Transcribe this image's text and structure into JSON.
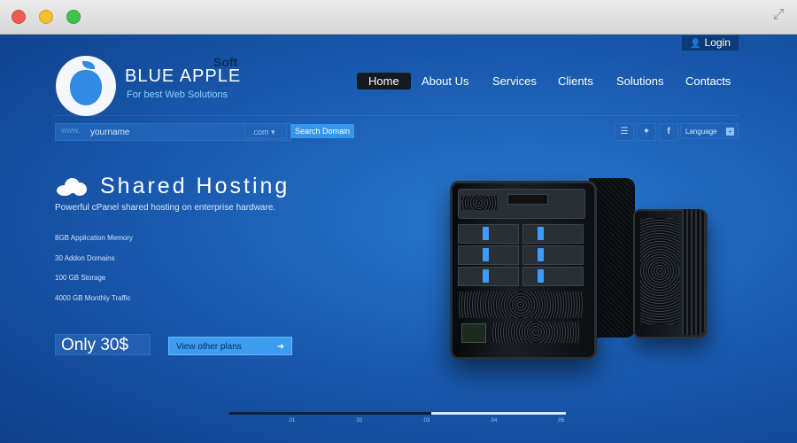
{
  "browser": {
    "expand_icon": "expand-arrows-icon"
  },
  "header": {
    "login_label": "Login",
    "logo": {
      "soft": "Soft",
      "name": "BLUE APPLE",
      "tagline": "For best Web Solutions"
    },
    "nav": [
      "Home",
      "About Us",
      "Services",
      "Clients",
      "Solutions",
      "Contacts"
    ],
    "nav_active": "Home"
  },
  "domain_search": {
    "prefix": "www.",
    "value": "yourname",
    "tld": ".com",
    "button_label": "Search Domain"
  },
  "social": {
    "icons": [
      "rss-icon",
      "twitter-icon",
      "facebook-icon"
    ],
    "language_label": "Language"
  },
  "hero": {
    "title": "Shared Hosting",
    "subtitle": "Powerful cPanel shared hosting on enterprise hardware.",
    "features": [
      "8GB Application Memory",
      "30 Addon Domains",
      "100 GB Storage",
      "4000 GB Monthly Traffic"
    ],
    "price": "Only 30$",
    "plans_button": "View other plans"
  },
  "slider": {
    "ticks": [
      ".01",
      ".02",
      ".03",
      ".04",
      ".05"
    ],
    "progress": 0.6
  },
  "colors": {
    "accent": "#3c9cf0",
    "page_bg": "#1a5bb0",
    "nav_active_bg": "#151a21"
  }
}
